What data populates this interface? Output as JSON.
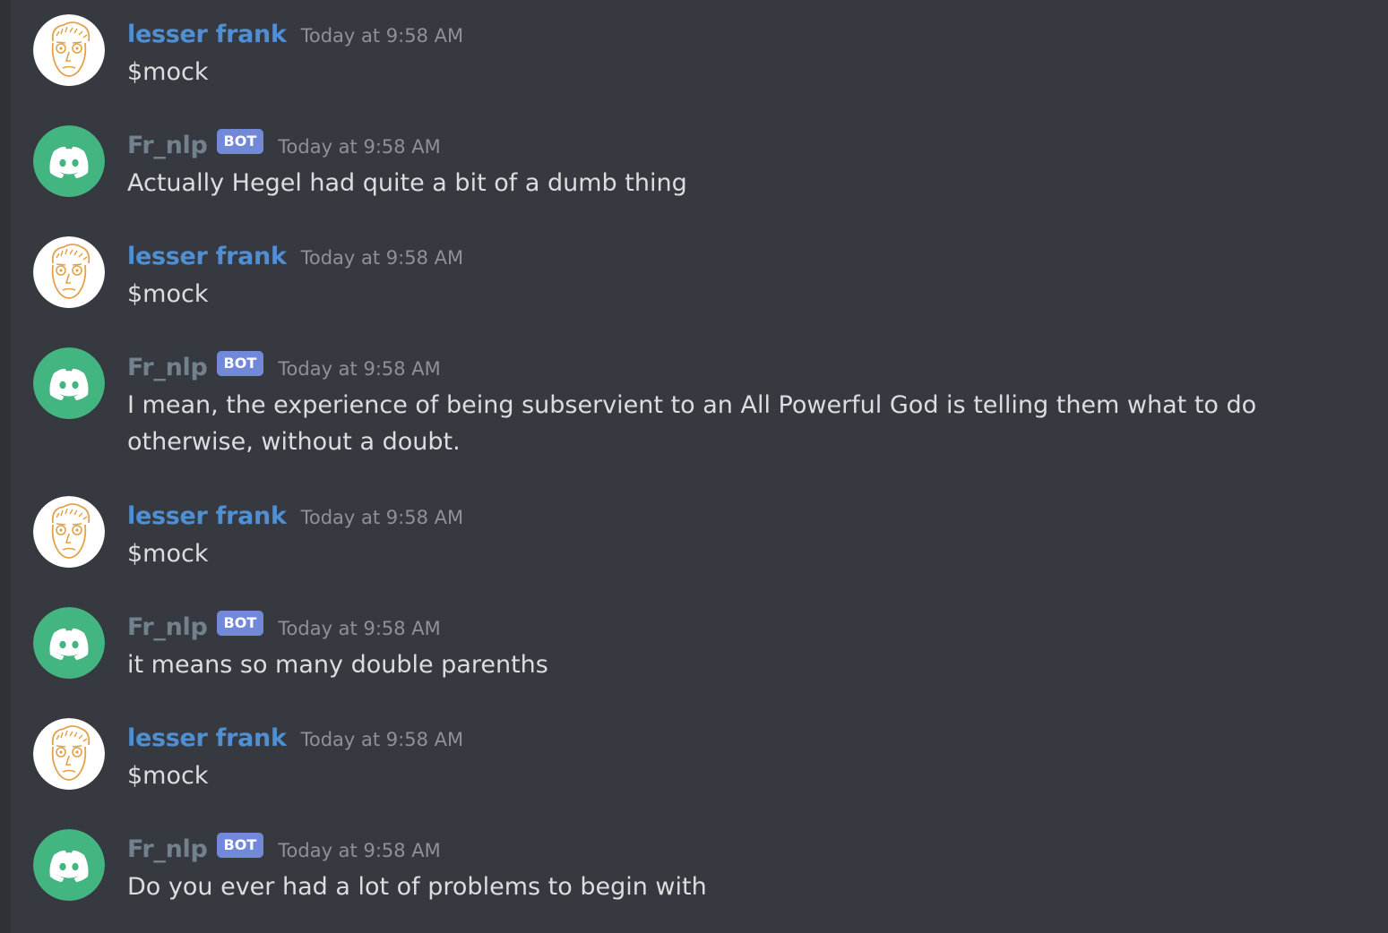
{
  "colors": {
    "background": "#36393f",
    "user_name": "#4f8fd2",
    "bot_name": "#73818c",
    "bot_tag": "#7289da",
    "timestamp": "#8e9297",
    "message_text": "#dcddde",
    "bot_avatar": "#43b581"
  },
  "messages": [
    {
      "author": "lesser frank",
      "is_bot": false,
      "bot_tag": "",
      "timestamp": "Today at 9:58 AM",
      "text": "$mock",
      "avatar_icon": "sketch-face-avatar-icon"
    },
    {
      "author": "Fr_nlp",
      "is_bot": true,
      "bot_tag": "BOT",
      "timestamp": "Today at 9:58 AM",
      "text": "Actually Hegel had quite a bit of a dumb thing",
      "avatar_icon": "discord-logo-avatar-icon"
    },
    {
      "author": "lesser frank",
      "is_bot": false,
      "bot_tag": "",
      "timestamp": "Today at 9:58 AM",
      "text": "$mock",
      "avatar_icon": "sketch-face-avatar-icon"
    },
    {
      "author": "Fr_nlp",
      "is_bot": true,
      "bot_tag": "BOT",
      "timestamp": "Today at 9:58 AM",
      "text": "I mean, the experience of being subservient to an All Powerful God is telling them what to do otherwise, without a doubt.",
      "avatar_icon": "discord-logo-avatar-icon"
    },
    {
      "author": "lesser frank",
      "is_bot": false,
      "bot_tag": "",
      "timestamp": "Today at 9:58 AM",
      "text": "$mock",
      "avatar_icon": "sketch-face-avatar-icon"
    },
    {
      "author": "Fr_nlp",
      "is_bot": true,
      "bot_tag": "BOT",
      "timestamp": "Today at 9:58 AM",
      "text": "it means so many double parenths",
      "avatar_icon": "discord-logo-avatar-icon"
    },
    {
      "author": "lesser frank",
      "is_bot": false,
      "bot_tag": "",
      "timestamp": "Today at 9:58 AM",
      "text": "$mock",
      "avatar_icon": "sketch-face-avatar-icon"
    },
    {
      "author": "Fr_nlp",
      "is_bot": true,
      "bot_tag": "BOT",
      "timestamp": "Today at 9:58 AM",
      "text": "Do you ever had a lot of problems to begin with",
      "avatar_icon": "discord-logo-avatar-icon"
    }
  ]
}
